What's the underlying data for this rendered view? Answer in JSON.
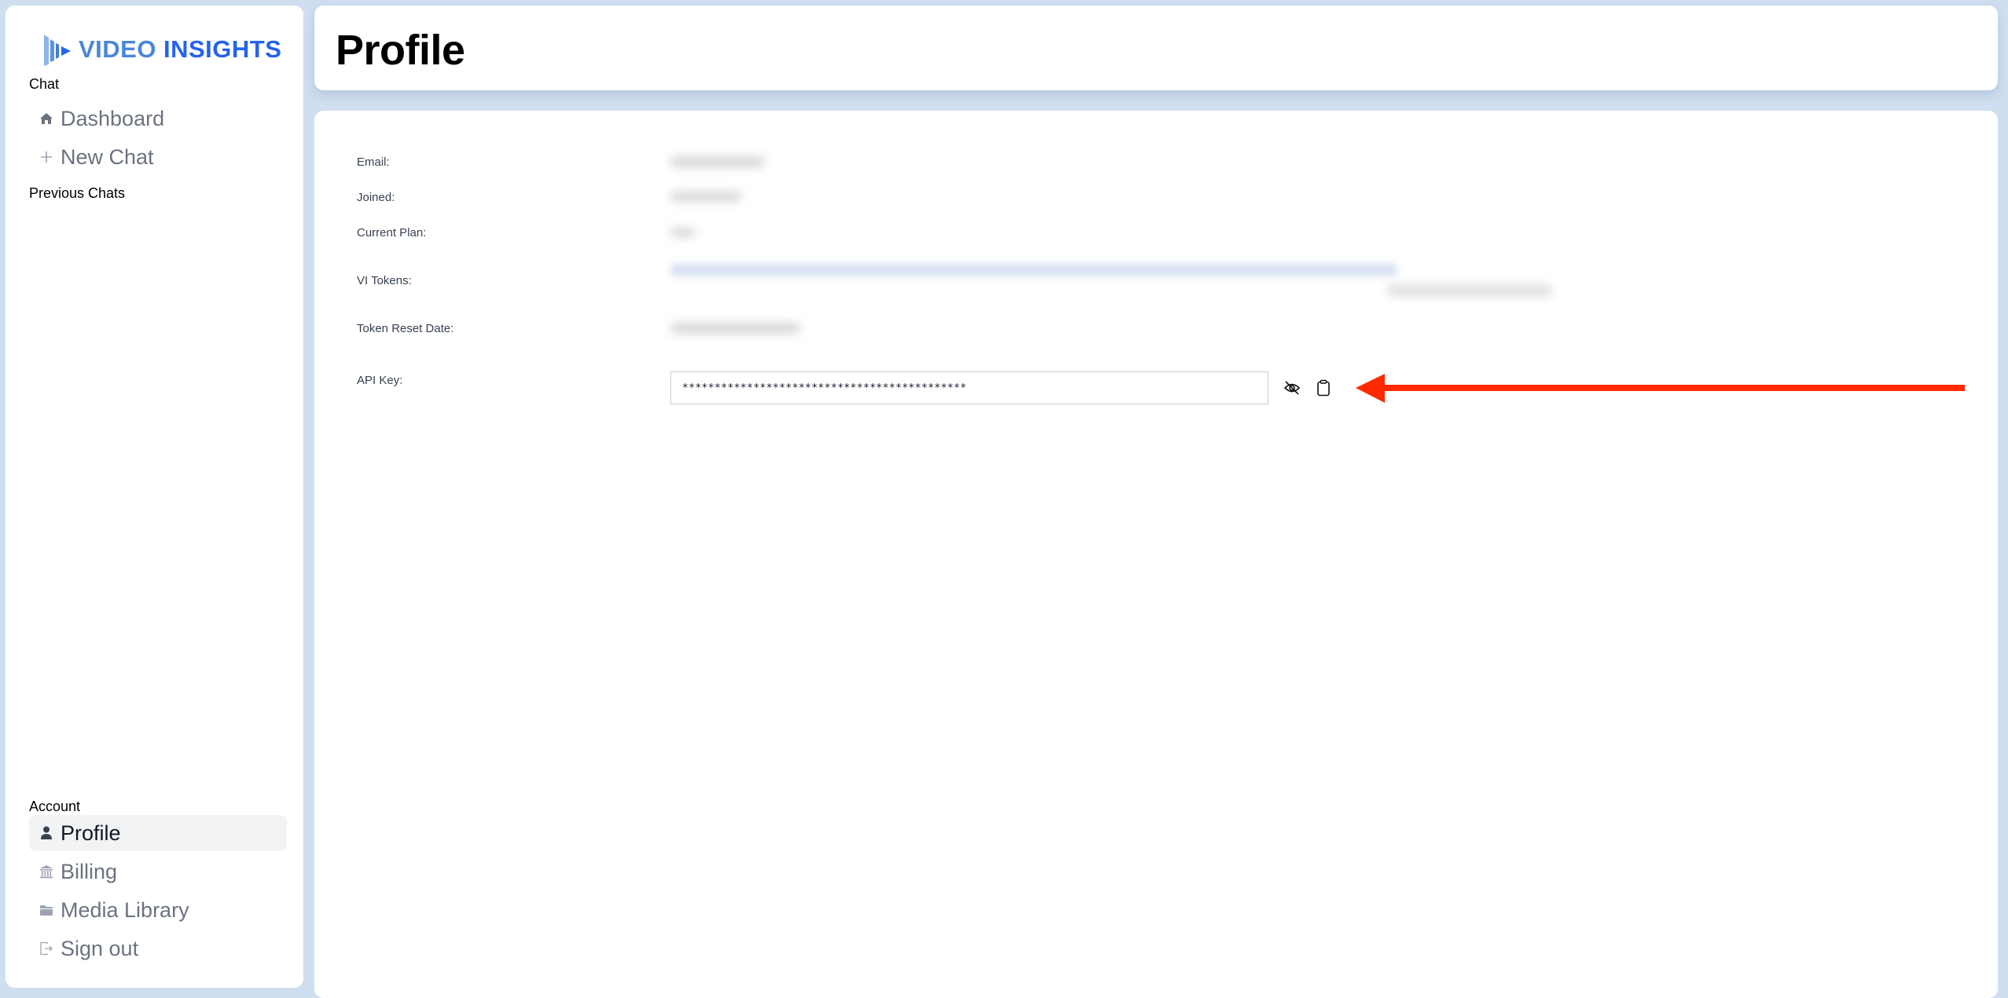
{
  "app": {
    "logo_word1": "VIDEO",
    "logo_word2": "INSIGHTS",
    "brand_colors": {
      "primary": "#2563eb",
      "secondary": "#4a86d9"
    }
  },
  "sidebar": {
    "chat_section_label": "Chat",
    "chat_items": [
      {
        "label": "Dashboard",
        "icon": "home-icon"
      },
      {
        "label": "New Chat",
        "icon": "plus-icon"
      }
    ],
    "previous_chats_label": "Previous Chats",
    "account_section_label": "Account",
    "account_items": [
      {
        "label": "Profile",
        "icon": "user-icon",
        "active": true
      },
      {
        "label": "Billing",
        "icon": "bank-icon",
        "active": false
      },
      {
        "label": "Media Library",
        "icon": "folder-icon",
        "active": false
      },
      {
        "label": "Sign out",
        "icon": "sign-out-icon",
        "active": false
      }
    ]
  },
  "header": {
    "title": "Profile"
  },
  "profile": {
    "fields": [
      {
        "label": "Email:",
        "value_blurred": true
      },
      {
        "label": "Joined:",
        "value_blurred": true
      },
      {
        "label": "Current Plan:",
        "value_blurred": true
      },
      {
        "label": "VI Tokens:",
        "value_blurred": true
      },
      {
        "label": "Token Reset Date:",
        "value_blurred": true
      }
    ],
    "api_key": {
      "label": "API Key:",
      "masked_value": "********************************************",
      "toggle_visibility_icon": "eye-off-icon",
      "copy_icon": "clipboard-icon"
    }
  },
  "annotation": {
    "type": "arrow",
    "color": "#ff2a00",
    "points_to": "api-key-actions"
  }
}
